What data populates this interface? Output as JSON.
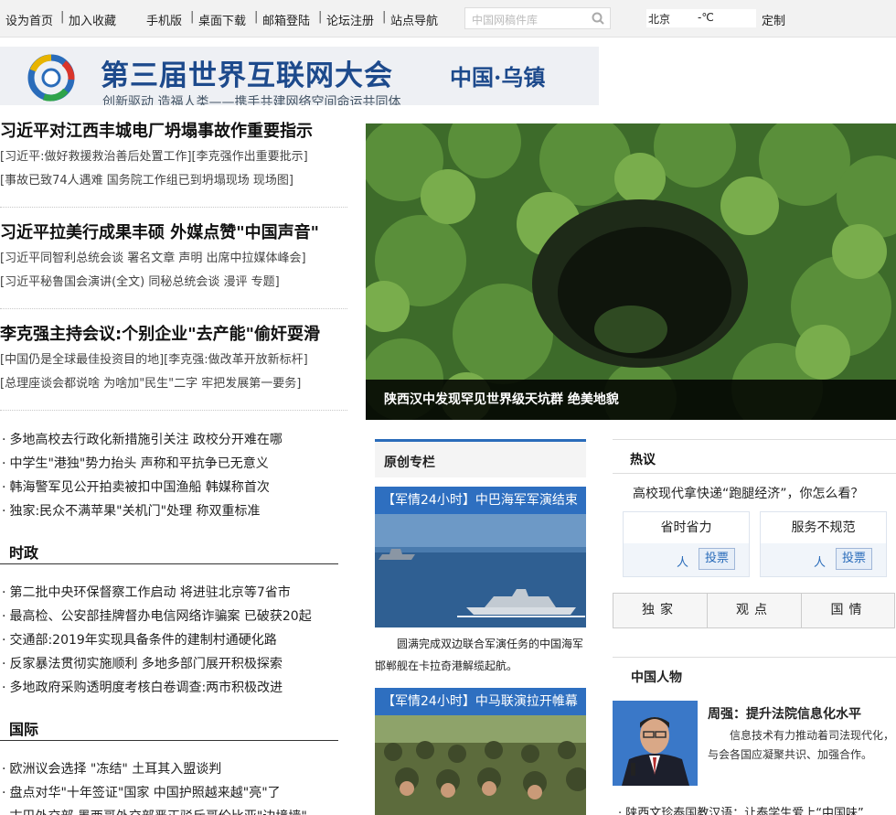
{
  "topbar": {
    "links": [
      "设为首页",
      "加入收藏",
      "手机版",
      "桌面下载",
      "邮箱登陆",
      "论坛注册",
      "站点导航"
    ],
    "search_placeholder": "中国网稿件库",
    "weather_city": "北京",
    "weather_temp": "-℃",
    "customize": "定制"
  },
  "banner": {
    "title": "第三届世界互联网大会",
    "place": "中国·乌镇",
    "slogan": "创新驱动 造福人类——携手共建网络空间命运共同体"
  },
  "stories": [
    {
      "title": "习近平对江西丰城电厂坍塌事故作重要指示",
      "subs": [
        "[习近平:做好救援救治善后处置工作][李克强作出重要批示]",
        "[事故已致74人遇难 国务院工作组已到坍塌现场 现场图]"
      ]
    },
    {
      "title": "习近平拉美行成果丰硕 外媒点赞\"中国声音\"",
      "subs": [
        "[习近平同智利总统会谈 署名文章 声明 出席中拉媒体峰会]",
        "[习近平秘鲁国会演讲(全文) 同秘总统会谈 漫评 专题]"
      ]
    },
    {
      "title": "李克强主持会议:个别企业\"去产能\"偷奸耍滑",
      "subs": [
        "[中国仍是全球最佳投资目的地][李克强:做改革开放新标杆]",
        "[总理座谈会都说啥 为啥加\"民生\"二字 牢把发展第一要务]"
      ]
    }
  ],
  "hero": {
    "caption": "陕西汉中发现罕见世界级天坑群  绝美地貌"
  },
  "news_list": [
    "多地高校去行政化新措施引关注 政校分开难在哪",
    "中学生\"港独\"势力抬头 声称和平抗争已无意义",
    "韩海警军见公开拍卖被扣中国渔船 韩媒称首次",
    "独家:民众不满苹果\"关机门\"处理 称双重标准"
  ],
  "politics": {
    "heading": "时政",
    "items": [
      "第二批中央环保督察工作启动 将进驻北京等7省市",
      "最高检、公安部挂牌督办电信网络诈骗案  已破获20起",
      "交通部:2019年实现具备条件的建制村通硬化路",
      "反家暴法贯彻实施顺利 多地多部门展开积极探索",
      "多地政府采购透明度考核白卷调查:两市积极改进"
    ]
  },
  "international": {
    "heading": "国际",
    "items": [
      "欧洲议会选择 \"冻结\" 土耳其入盟谈判",
      "盘点对华\"十年签证\"国家 中国护照越来越\"亮\"了",
      "古巴外交部 墨西哥外交部严正驳斥哥伦比亚\"边境墙\""
    ]
  },
  "original": {
    "heading": "原创专栏",
    "item1_title": "【军情24小时】中巴海军军演结束",
    "item1_caption": "圆满完成双边联合军演任务的中国海军 邯郸舰在卡拉奇港解缆起航。",
    "item2_title": "【军情24小时】中马联演拉开帷幕"
  },
  "debate": {
    "heading": "热议",
    "question": "高校现代拿快递“跑腿经济”，你怎么看？",
    "options": [
      {
        "label": "省时省力",
        "people": "人",
        "vote": "投票"
      },
      {
        "label": "服务不规范",
        "people": "人",
        "vote": "投票"
      }
    ]
  },
  "tabs": [
    "独家",
    "观点",
    "国情"
  ],
  "people": {
    "heading": "中国人物",
    "name_title": "周强：提升法院信息化水平",
    "summary": "信息技术有力推动着司法现代化，与会各国应凝聚共识、加强合作。",
    "more": "陕西文珍泰国教汉语：让泰学生爱上“中国味”"
  },
  "colors": {
    "accent": "#2e6fc0",
    "banner_text": "#1d4a8c"
  }
}
